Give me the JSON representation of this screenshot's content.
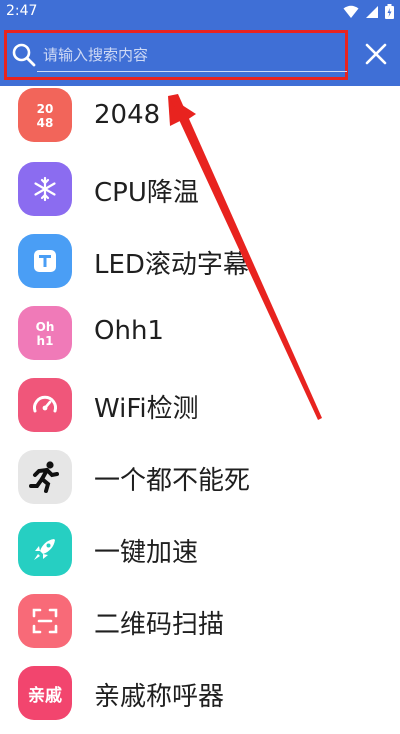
{
  "status_bar": {
    "time": "2:47",
    "icons": [
      "wifi-icon",
      "signal-icon",
      "battery-icon"
    ]
  },
  "search": {
    "placeholder": "请输入搜索内容",
    "value": ""
  },
  "colors": {
    "appbar": "#3f6fd6",
    "highlight": "#e8231f"
  },
  "apps": [
    {
      "name": "2048",
      "icon": "2048-icon",
      "icon_text": "20\n48",
      "color": "#f2655a"
    },
    {
      "name": "CPU降温",
      "icon": "snowflake-icon",
      "color": "#8b6cf0"
    },
    {
      "name": "LED滚动字幕",
      "icon": "text-t-icon",
      "color": "#4a9ef5"
    },
    {
      "name": "Ohh1",
      "icon": "ohh1-icon",
      "icon_text": "Oh\nh1",
      "color": "#f07ab8"
    },
    {
      "name": "WiFi检测",
      "icon": "speedometer-icon",
      "color": "#f0567a"
    },
    {
      "name": "一个都不能死",
      "icon": "running-man-icon",
      "color": "#e6e6e6"
    },
    {
      "name": "一键加速",
      "icon": "rocket-icon",
      "color": "#26cfc2"
    },
    {
      "name": "二维码扫描",
      "icon": "scan-icon",
      "color": "#f86a78"
    },
    {
      "name": "亲戚称呼器",
      "icon": "relatives-icon",
      "icon_text": "亲戚",
      "color": "#f2456e"
    }
  ]
}
